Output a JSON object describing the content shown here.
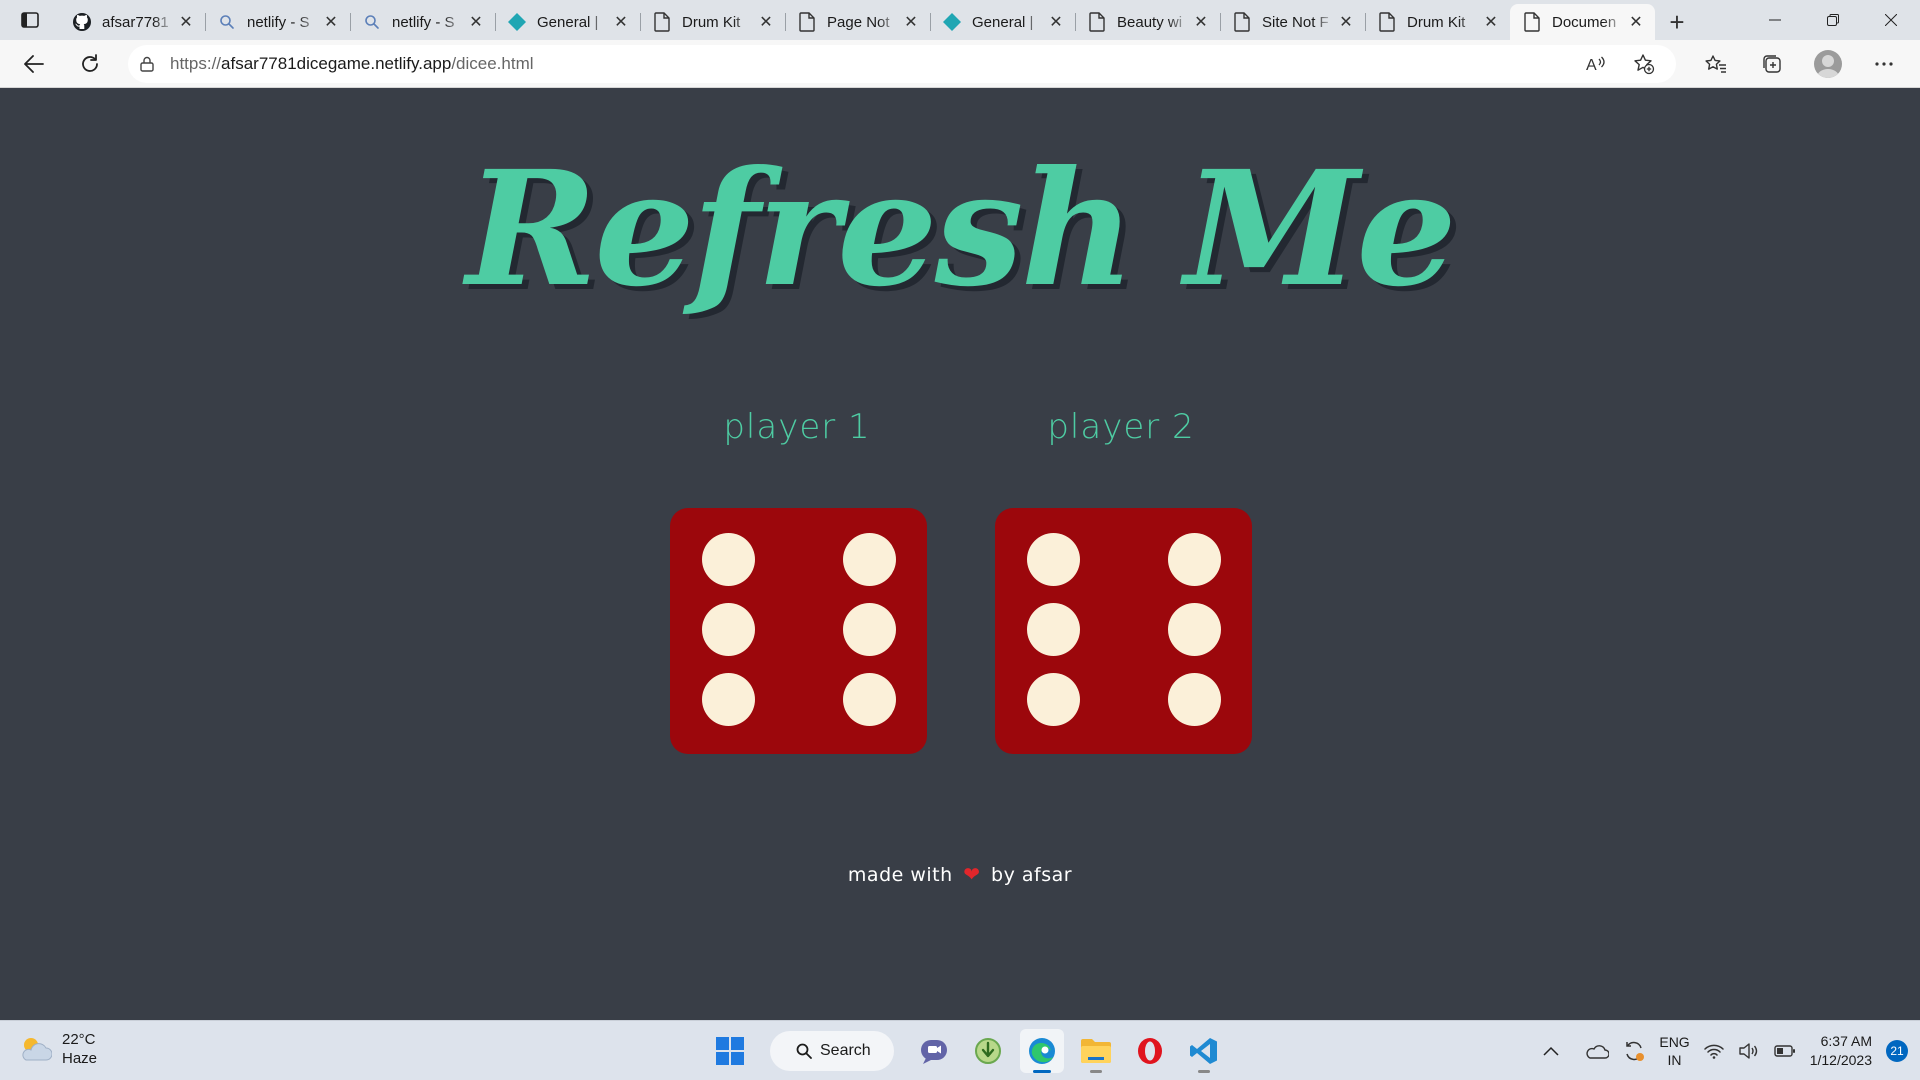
{
  "browser": {
    "tabs": [
      {
        "title": "afsar7781",
        "icon": "github-icon"
      },
      {
        "title": "netlify - S",
        "icon": "search-icon"
      },
      {
        "title": "netlify - S",
        "icon": "search-icon"
      },
      {
        "title": "General |",
        "icon": "netlify-icon"
      },
      {
        "title": "Drum Kit",
        "icon": "page-icon"
      },
      {
        "title": "Page Not",
        "icon": "page-icon"
      },
      {
        "title": "General |",
        "icon": "netlify-icon"
      },
      {
        "title": "Beauty wi",
        "icon": "page-icon"
      },
      {
        "title": "Site Not F",
        "icon": "page-icon"
      },
      {
        "title": "Drum Kit",
        "icon": "page-icon"
      },
      {
        "title": "Documen",
        "icon": "page-icon",
        "active": true
      }
    ],
    "url": {
      "scheme": "https://",
      "host": "afsar7781dicegame.netlify.app",
      "path": "/dicee.html"
    }
  },
  "page": {
    "title": "Refresh Me",
    "player1_label": "player 1",
    "player2_label": "player 2",
    "dice": [
      6,
      6
    ],
    "footer": {
      "before": "made with",
      "heart": "❤",
      "after": "by afsar"
    },
    "colors": {
      "background": "#393e47",
      "accent": "#4ecca3",
      "die": "#9c070c",
      "pip": "#fbf0d9"
    }
  },
  "taskbar": {
    "weather": {
      "temp": "22°C",
      "condition": "Haze"
    },
    "search_label": "Search",
    "language": {
      "line1": "ENG",
      "line2": "IN"
    },
    "time": "6:37 AM",
    "date": "1/12/2023",
    "notification_count": "21"
  }
}
